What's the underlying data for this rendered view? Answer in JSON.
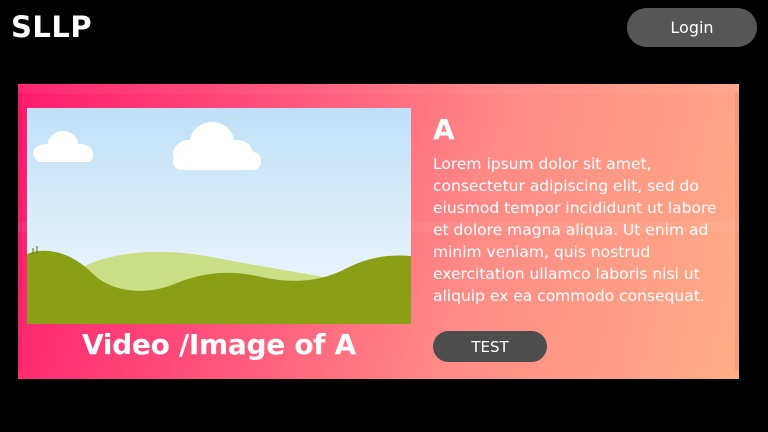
{
  "header": {
    "logo_text": "SLLP",
    "login_label": "Login"
  },
  "card": {
    "media_caption": "Video /Image of A",
    "title": "A",
    "body": "Lorem ipsum dolor sit amet, consectetur adipiscing elit, sed do eiusmod tempor incididunt ut labore et dolore magna aliqua. Ut enim ad minim veniam, quis nostrud exercitation ullamco laboris nisi ut aliquip ex ea commodo consequat.",
    "button_label": "TEST"
  },
  "colors": {
    "background": "#000000",
    "button_gray": "#565656",
    "gradient_start": "#ff1a6d",
    "gradient_end": "#ffad86",
    "sky": "#cfe8f8",
    "hill_dark": "#8a9e16",
    "hill_light": "#c8de86"
  },
  "icons": {
    "media_placeholder": "landscape-image-icon"
  }
}
